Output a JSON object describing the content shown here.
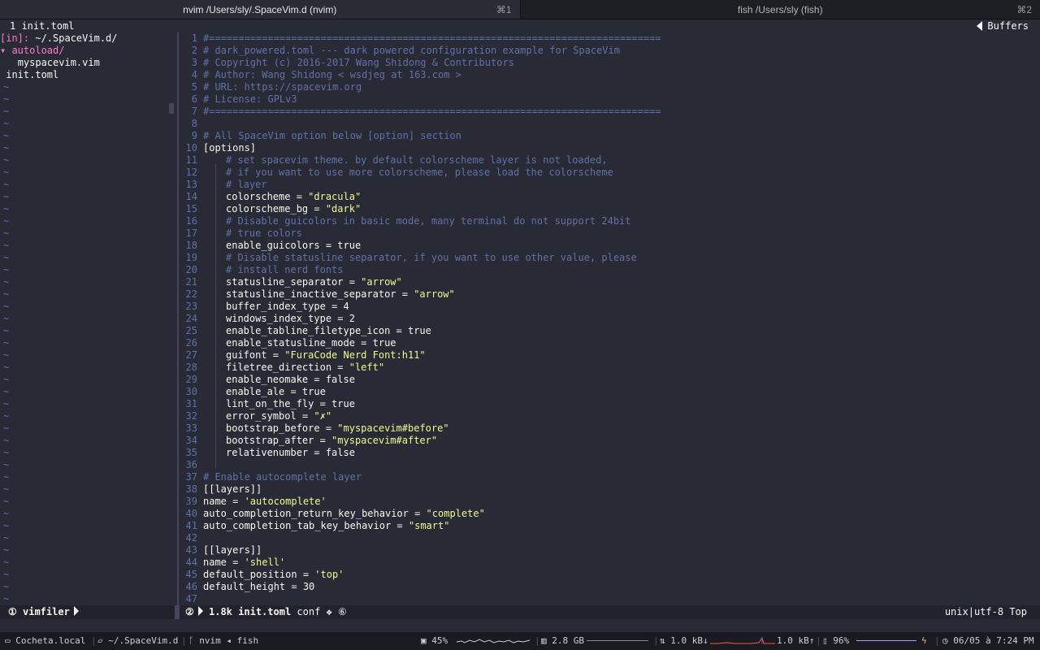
{
  "tabs": [
    {
      "title": "nvim /Users/sly/.SpaceVim.d (nvim)",
      "shortcut": "⌘1"
    },
    {
      "title": "fish /Users/sly (fish)",
      "shortcut": "⌘2"
    }
  ],
  "tabline": {
    "buffer_label": "1 init.toml",
    "buffers_label": "Buffers"
  },
  "filetree": {
    "header_prefix": "[in]:",
    "header_path": " ~/.SpaceVim.d/",
    "folder": "autoload/",
    "folder_file": "myspacevim.vim",
    "root_file": "init.toml"
  },
  "editor": {
    "lines": [
      {
        "n": "1",
        "code": "#============================================================================="
      },
      {
        "n": "2",
        "code": "# dark_powered.toml --- dark powered configuration example for SpaceVim"
      },
      {
        "n": "3",
        "code": "# Copyright (c) 2016-2017 Wang Shidong & Contributors"
      },
      {
        "n": "4",
        "code": "# Author: Wang Shidong < wsdjeg at 163.com >"
      },
      {
        "n": "5",
        "code": "# URL: https://spacevim.org"
      },
      {
        "n": "6",
        "code": "# License: GPLv3"
      },
      {
        "n": "7",
        "code": "#============================================================================="
      },
      {
        "n": "8",
        "code": ""
      },
      {
        "n": "9",
        "code": "# All SpaceVim option below [option] section"
      },
      {
        "n": "10",
        "code": "[options]"
      },
      {
        "n": "11",
        "code": "# set spacevim theme. by default colorscheme layer is not loaded,"
      },
      {
        "n": "12",
        "code": "# if you want to use more colorscheme, please load the colorscheme"
      },
      {
        "n": "13",
        "code": "# layer"
      },
      {
        "n": "14",
        "code": "colorscheme = ",
        "val": "\"dracula\""
      },
      {
        "n": "15",
        "code": "colorscheme_bg = ",
        "val": "\"dark\""
      },
      {
        "n": "16",
        "code": "# Disable guicolors in basic mode, many terminal do not support 24bit"
      },
      {
        "n": "17",
        "code": "# true colors"
      },
      {
        "n": "18",
        "code": "enable_guicolors = true"
      },
      {
        "n": "19",
        "code": "# Disable statusline separator, if you want to use other value, please"
      },
      {
        "n": "20",
        "code": "# install nerd fonts"
      },
      {
        "n": "21",
        "code": "statusline_separator = ",
        "val": "\"arrow\""
      },
      {
        "n": "22",
        "code": "statusline_inactive_separator = ",
        "val": "\"arrow\""
      },
      {
        "n": "23",
        "code": "buffer_index_type = 4"
      },
      {
        "n": "24",
        "code": "windows_index_type = 2"
      },
      {
        "n": "25",
        "code": "enable_tabline_filetype_icon = true"
      },
      {
        "n": "26",
        "code": "enable_statusline_mode = true"
      },
      {
        "n": "27",
        "code": "guifont = ",
        "val": "\"FuraCode Nerd Font:h11\""
      },
      {
        "n": "28",
        "code": "filetree_direction = ",
        "val": "\"left\""
      },
      {
        "n": "29",
        "code": "enable_neomake = false"
      },
      {
        "n": "30",
        "code": "enable_ale = true"
      },
      {
        "n": "31",
        "code": "lint_on_the_fly = true"
      },
      {
        "n": "32",
        "code": "error_symbol = ",
        "val": "\"✗\""
      },
      {
        "n": "33",
        "code": "bootstrap_before = ",
        "val": "\"myspacevim#before\""
      },
      {
        "n": "34",
        "code": "bootstrap_after = ",
        "val": "\"myspacevim#after\""
      },
      {
        "n": "35",
        "code": "relativenumber = false"
      },
      {
        "n": "36",
        "code": ""
      },
      {
        "n": "37",
        "code": "# Enable autocomplete layer"
      },
      {
        "n": "38",
        "code": "[[layers]]"
      },
      {
        "n": "39",
        "code": "name = ",
        "val": "'autocomplete'"
      },
      {
        "n": "40",
        "code": "auto_completion_return_key_behavior = ",
        "val": "\"complete\""
      },
      {
        "n": "41",
        "code": "auto_completion_tab_key_behavior = ",
        "val": "\"smart\""
      },
      {
        "n": "42",
        "code": ""
      },
      {
        "n": "43",
        "code": "[[layers]]"
      },
      {
        "n": "44",
        "code": "name = ",
        "val": "'shell'"
      },
      {
        "n": "45",
        "code": "default_position = ",
        "val": "'top'"
      },
      {
        "n": "46",
        "code": "default_height = 30"
      },
      {
        "n": "47",
        "code": ""
      }
    ]
  },
  "statusline": {
    "left_num": "①",
    "left_label": "vimfiler",
    "win_num": "②",
    "size": "1.8k",
    "filename": "init.toml",
    "filetype": "conf",
    "ale": "❖ ⑥",
    "encoding": "unix|utf-8",
    "position": "Top"
  },
  "tmux": {
    "host": "Cocheta.local",
    "path": "~/.SpaceVim.d",
    "process": "nvim ◂ fish",
    "cpu": "45%",
    "mem": "2.8 GB",
    "net_down": "1.0 kB↓",
    "net_up": "1.0 kB↑",
    "battery": "96%",
    "datetime": "06/05 à 7:24 PM"
  },
  "colors": {
    "background": "#282a36",
    "comment": "#6272a4",
    "string": "#f1fa8c",
    "accent": "#ff79c6"
  }
}
